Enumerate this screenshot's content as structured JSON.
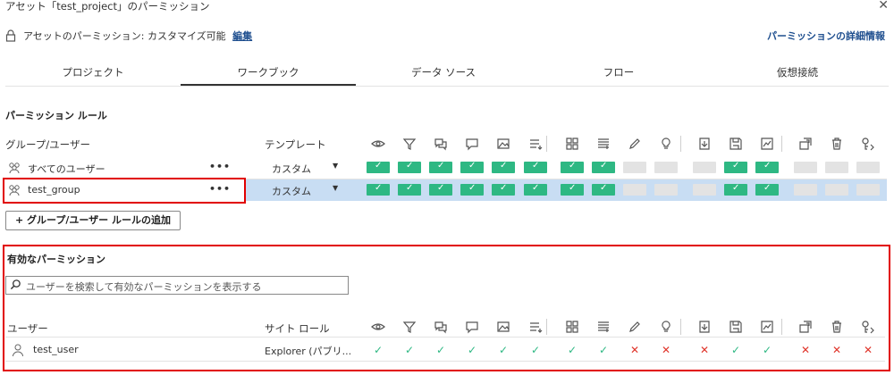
{
  "dialog": {
    "title": "アセット「test_project」のパーミッション",
    "close_icon": "close-icon",
    "permission_status": "アセットのパーミッション: カスタマイズ可能",
    "edit_label": "編集",
    "details_link": "パーミッションの詳細情報"
  },
  "tabs": [
    {
      "label": "プロジェクト",
      "active": false
    },
    {
      "label": "ワークブック",
      "active": true
    },
    {
      "label": "データ ソース",
      "active": false
    },
    {
      "label": "フロー",
      "active": false
    },
    {
      "label": "仮想接続",
      "active": false
    }
  ],
  "rules": {
    "section_title": "パーミッション ルール",
    "col_group_user": "グループ/ユーザー",
    "col_template": "テンプレート",
    "capability_icons": [
      "view-icon",
      "filter-icon",
      "comments-icon",
      "add-comment-icon",
      "image-export-icon",
      "summary-data-icon",
      "full-data-icon",
      "web-edit-icon",
      "edit-pencil-icon",
      "explain-data-icon",
      "download-icon",
      "save-icon",
      "metrics-icon",
      "move-icon",
      "delete-icon",
      "set-permissions-icon"
    ],
    "rows": [
      {
        "name": "すべてのユーザー",
        "menu": "•••",
        "template": "カスタム",
        "selected": false,
        "cells": [
          "g",
          "g",
          "g",
          "g",
          "g",
          "g",
          "g",
          "g",
          "e",
          "e",
          "e",
          "g",
          "g",
          "e",
          "e",
          "e"
        ]
      },
      {
        "name": "test_group",
        "menu": "•••",
        "template": "カスタム",
        "selected": true,
        "cells": [
          "g",
          "g",
          "g",
          "g",
          "g",
          "g",
          "g",
          "g",
          "e",
          "e",
          "e",
          "g",
          "g",
          "e",
          "e",
          "e"
        ]
      }
    ],
    "add_button": "+ グループ/ユーザー ルールの追加"
  },
  "effective": {
    "section_title": "有効なパーミッション",
    "search_placeholder": "ユーザーを検索して有効なパーミッションを表示する",
    "col_user": "ユーザー",
    "col_site_role": "サイト ロール",
    "rows": [
      {
        "name": "test_user",
        "site_role": "Explorer (パブリ...",
        "marks": [
          "ok",
          "ok",
          "ok",
          "ok",
          "ok",
          "ok",
          "ok",
          "ok",
          "no",
          "no",
          "no",
          "ok",
          "ok",
          "no",
          "no",
          "no"
        ]
      }
    ]
  },
  "colors": {
    "allowed": "#2eb883",
    "denied": "#e0352b",
    "selected_row": "#c8ddf3",
    "highlight": "#e10000",
    "link": "#1f4f8f"
  }
}
